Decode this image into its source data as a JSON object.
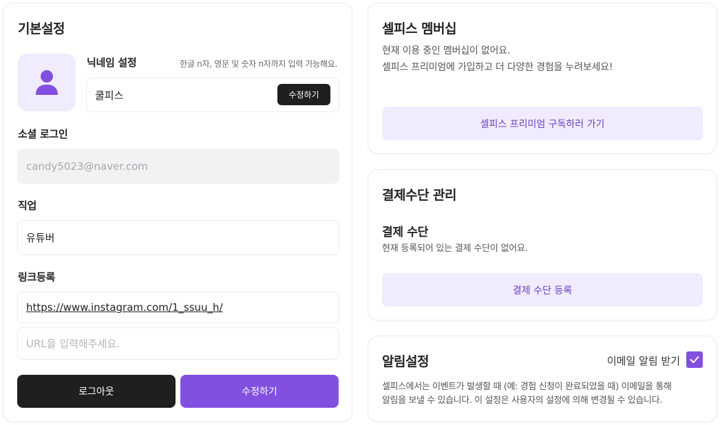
{
  "colors": {
    "accent": "#8250e0",
    "accent_light": "#f1ecfd",
    "dark": "#1f1f1f"
  },
  "basic": {
    "title": "기본설정",
    "avatar_icon": "user-icon",
    "nickname": {
      "label": "닉네임 설정",
      "hint": "한글 n자, 영문 및 숫자 n자까지 입력 가능해요.",
      "value": "쿨피스",
      "edit_label": "수정하기"
    },
    "social": {
      "label": "소셜 로그인",
      "value": "candy5023@naver.com"
    },
    "job": {
      "label": "직업",
      "value": "유튜버"
    },
    "links": {
      "label": "링크등록",
      "items": [
        "https://www.instagram.com/1_ssuu_h/"
      ],
      "placeholder": "URL을 입력해주세요."
    },
    "logout_label": "로그아웃",
    "save_label": "수정하기"
  },
  "membership": {
    "title": "셀피스 멤버십",
    "line1": "현재 이용 중인 멤버십이 없어요.",
    "line2": "셀피스 프리미엄에 가입하고 더 다양한 경험을 누려보세요!",
    "cta": "셀피스 프리미엄 구독하러 가기"
  },
  "payment": {
    "title": "결제수단 관리",
    "subtitle": "결제 수단",
    "desc": "현재 등록되어 있는 결제 수단이 없어요.",
    "cta": "결제 수단 등록"
  },
  "notification": {
    "title": "알림설정",
    "email_label": "이메일 알림 받기",
    "email_checked": true,
    "desc1": "셀피스에서는 이벤트가 발생할 때 (예: 경험 신청이 완료되었을 때) 이메일을 통해",
    "desc2": "알림을 보낼 수 있습니다. 이 설정은 사용자의 설정에 의해 변경될 수 있습니다."
  }
}
